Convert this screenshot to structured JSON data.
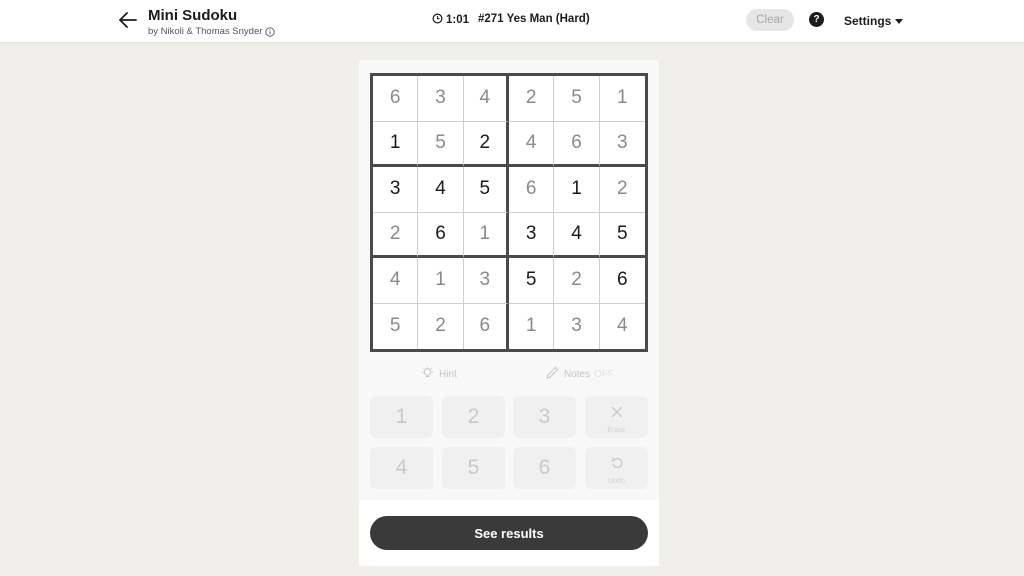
{
  "header": {
    "title": "Mini Sudoku",
    "byline": "by Nikoli & Thomas Snyder",
    "timer": "1:01",
    "puzzle_name": "#271 Yes Man (Hard)",
    "clear_label": "Clear",
    "help_label": "?",
    "settings_label": "Settings"
  },
  "grid": {
    "rows": [
      [
        {
          "v": "6",
          "given": false
        },
        {
          "v": "3",
          "given": false
        },
        {
          "v": "4",
          "given": false
        },
        {
          "v": "2",
          "given": false
        },
        {
          "v": "5",
          "given": false
        },
        {
          "v": "1",
          "given": false
        }
      ],
      [
        {
          "v": "1",
          "given": true
        },
        {
          "v": "5",
          "given": false
        },
        {
          "v": "2",
          "given": true
        },
        {
          "v": "4",
          "given": false
        },
        {
          "v": "6",
          "given": false
        },
        {
          "v": "3",
          "given": false
        }
      ],
      [
        {
          "v": "3",
          "given": true
        },
        {
          "v": "4",
          "given": true
        },
        {
          "v": "5",
          "given": true
        },
        {
          "v": "6",
          "given": false
        },
        {
          "v": "1",
          "given": true
        },
        {
          "v": "2",
          "given": false
        }
      ],
      [
        {
          "v": "2",
          "given": false
        },
        {
          "v": "6",
          "given": true
        },
        {
          "v": "1",
          "given": false
        },
        {
          "v": "3",
          "given": true
        },
        {
          "v": "4",
          "given": true
        },
        {
          "v": "5",
          "given": true
        }
      ],
      [
        {
          "v": "4",
          "given": false
        },
        {
          "v": "1",
          "given": false
        },
        {
          "v": "3",
          "given": false
        },
        {
          "v": "5",
          "given": true
        },
        {
          "v": "2",
          "given": false
        },
        {
          "v": "6",
          "given": true
        }
      ],
      [
        {
          "v": "5",
          "given": false
        },
        {
          "v": "2",
          "given": false
        },
        {
          "v": "6",
          "given": false
        },
        {
          "v": "1",
          "given": false
        },
        {
          "v": "3",
          "given": false
        },
        {
          "v": "4",
          "given": false
        }
      ]
    ]
  },
  "tools": {
    "hint_label": "Hint",
    "notes_label": "Notes",
    "notes_state": "OFF"
  },
  "keypad": {
    "k1": "1",
    "k2": "2",
    "k3": "3",
    "k4": "4",
    "k5": "5",
    "k6": "6",
    "erase_label": "Erase",
    "undo_label": "Undo"
  },
  "results_label": "See results",
  "colors": {
    "background": "#f1efeb",
    "given_digit": "#1a1a1a",
    "filled_digit": "#8a8a8a",
    "primary_button": "#3a3a3a"
  }
}
